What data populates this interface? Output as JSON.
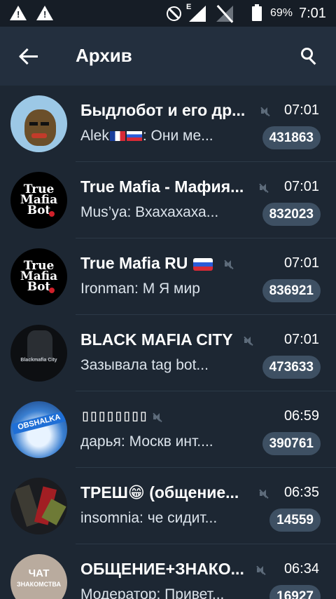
{
  "status_bar": {
    "warning_glyph": "!",
    "network_letter": "E",
    "battery": "69%",
    "time": "7:01"
  },
  "header": {
    "title": "Архив"
  },
  "chats": [
    {
      "name": "Быдлобот и его др...",
      "time": "07:01",
      "sender": "Alek",
      "message_tail": ": Они ме...",
      "unread": "431863"
    },
    {
      "name": "True Mafia - Мафия...",
      "time": "07:01",
      "message": "Mus’ya: Вхахахаха...",
      "unread": "832023",
      "avatar_text": [
        "True",
        "Mafia",
        "Bot"
      ]
    },
    {
      "name": "True Mafia RU",
      "time": "07:01",
      "message": "Ironman: М Я мир",
      "unread": "836921",
      "avatar_text": [
        "True",
        "Mafia",
        "Bot"
      ]
    },
    {
      "name": "BLACK MAFIA CITY",
      "time": "07:01",
      "message": "Зазывала tag bot...",
      "unread": "473633",
      "avatar_text": "Blackmafia City"
    },
    {
      "name": "▯▯▯▯▯▯▯▯",
      "time": "06:59",
      "message": "дарья: Москв инт....",
      "unread": "390761",
      "avatar_text": "OBSHALKA"
    },
    {
      "name": "ТРЕШ😁 (общение...",
      "time": "06:35",
      "message": "insomnia: че сидит...",
      "unread": "14559"
    },
    {
      "name": "ОБЩЕНИЕ+ЗНАКО...",
      "time": "06:34",
      "message": "Модератор: Привет...",
      "unread": "16927",
      "avatar_text": [
        "ЧАТ",
        "ЗНАКОМСТВА"
      ]
    }
  ],
  "icons": {
    "back": "arrow-left-icon",
    "search": "search-icon",
    "muted": "muted-speaker-icon"
  },
  "colors": {
    "background": "#1d2733",
    "header": "#232f3e",
    "badge": "#3e5063"
  }
}
